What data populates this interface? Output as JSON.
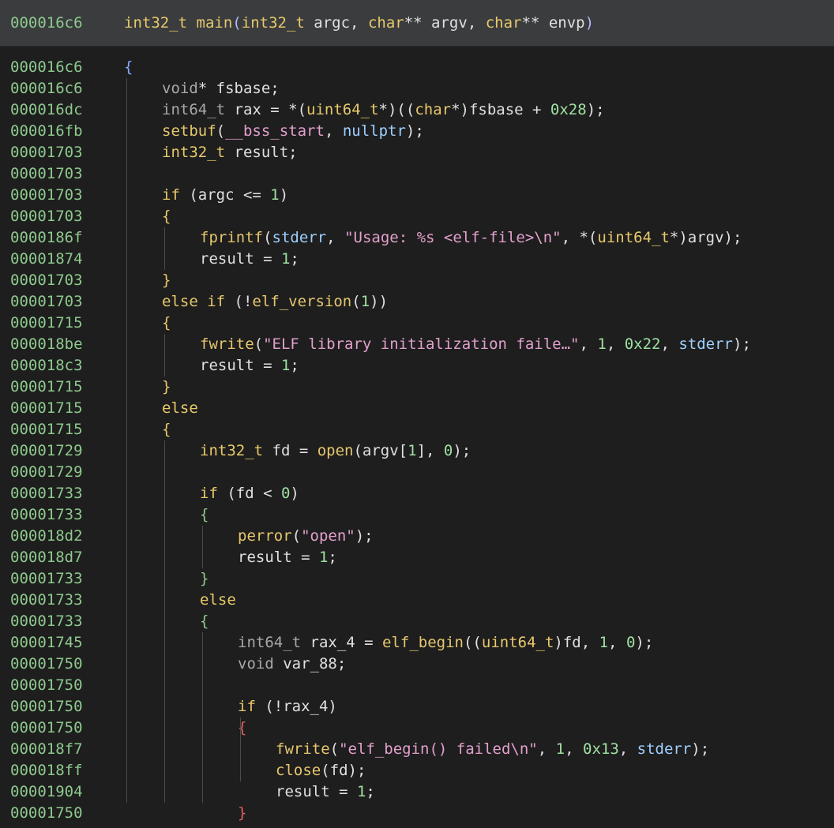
{
  "header": {
    "address": "000016c6",
    "return_type": "int32_t",
    "function_name": "main",
    "params": [
      {
        "type": "int32_t",
        "name": "argc"
      },
      {
        "type": "char",
        "ptr": "**",
        "name": "argv"
      },
      {
        "type": "char",
        "ptr": "**",
        "name": "envp"
      }
    ]
  },
  "lines": [
    {
      "addr": "000016c6",
      "indent": 0,
      "tokens": [
        [
          "{",
          "brace"
        ]
      ]
    },
    {
      "addr": "000016c6",
      "indent": 1,
      "tokens": [
        [
          "void",
          "type-dim"
        ],
        [
          "* fsbase;",
          "var"
        ]
      ]
    },
    {
      "addr": "000016dc",
      "indent": 1,
      "tokens": [
        [
          "int64_t",
          "type-dim"
        ],
        [
          " rax = *(",
          "var"
        ],
        [
          "uint64_t",
          "type"
        ],
        [
          "*)((",
          "var"
        ],
        [
          "char",
          "type"
        ],
        [
          "*)fsbase + ",
          "var"
        ],
        [
          "0x28",
          "num"
        ],
        [
          ");",
          "var"
        ]
      ]
    },
    {
      "addr": "000016fb",
      "indent": 1,
      "tokens": [
        [
          "setbuf",
          "func"
        ],
        [
          "(",
          "var"
        ],
        [
          "__bss_start",
          "pink"
        ],
        [
          ", ",
          "var"
        ],
        [
          "nullptr",
          "glob"
        ],
        [
          ");",
          "var"
        ]
      ]
    },
    {
      "addr": "00001703",
      "indent": 1,
      "tokens": [
        [
          "int32_t",
          "type"
        ],
        [
          " result;",
          "var"
        ]
      ]
    },
    {
      "addr": "00001703",
      "indent": 1,
      "tokens": []
    },
    {
      "addr": "00001703",
      "indent": 1,
      "tokens": [
        [
          "if",
          "kw"
        ],
        [
          " (argc <= ",
          "var"
        ],
        [
          "1",
          "num"
        ],
        [
          ")",
          "var"
        ]
      ]
    },
    {
      "addr": "00001703",
      "indent": 1,
      "tokens": [
        [
          "{",
          "brace-y"
        ]
      ]
    },
    {
      "addr": "0000186f",
      "indent": 2,
      "tokens": [
        [
          "fprintf",
          "func"
        ],
        [
          "(",
          "var"
        ],
        [
          "stderr",
          "glob"
        ],
        [
          ", ",
          "var"
        ],
        [
          "\"Usage: %s <elf-file>\\n\"",
          "str"
        ],
        [
          ", *(",
          "var"
        ],
        [
          "uint64_t",
          "type"
        ],
        [
          "*)argv);",
          "var"
        ]
      ]
    },
    {
      "addr": "00001874",
      "indent": 2,
      "tokens": [
        [
          "result = ",
          "var"
        ],
        [
          "1",
          "num"
        ],
        [
          ";",
          "var"
        ]
      ]
    },
    {
      "addr": "00001703",
      "indent": 1,
      "tokens": [
        [
          "}",
          "brace-y"
        ]
      ]
    },
    {
      "addr": "00001703",
      "indent": 1,
      "tokens": [
        [
          "else if",
          "kw"
        ],
        [
          " (!",
          "var"
        ],
        [
          "elf_version",
          "func"
        ],
        [
          "(",
          "var"
        ],
        [
          "1",
          "num"
        ],
        [
          "))",
          "var"
        ]
      ]
    },
    {
      "addr": "00001715",
      "indent": 1,
      "tokens": [
        [
          "{",
          "brace-y"
        ]
      ]
    },
    {
      "addr": "000018be",
      "indent": 2,
      "tokens": [
        [
          "fwrite",
          "func"
        ],
        [
          "(",
          "var"
        ],
        [
          "\"ELF library initialization faile…\"",
          "str"
        ],
        [
          ", ",
          "var"
        ],
        [
          "1",
          "num"
        ],
        [
          ", ",
          "var"
        ],
        [
          "0x22",
          "num"
        ],
        [
          ", ",
          "var"
        ],
        [
          "stderr",
          "glob"
        ],
        [
          ");",
          "var"
        ]
      ]
    },
    {
      "addr": "000018c3",
      "indent": 2,
      "tokens": [
        [
          "result = ",
          "var"
        ],
        [
          "1",
          "num"
        ],
        [
          ";",
          "var"
        ]
      ]
    },
    {
      "addr": "00001715",
      "indent": 1,
      "tokens": [
        [
          "}",
          "brace-y"
        ]
      ]
    },
    {
      "addr": "00001715",
      "indent": 1,
      "tokens": [
        [
          "else",
          "kw"
        ]
      ]
    },
    {
      "addr": "00001715",
      "indent": 1,
      "tokens": [
        [
          "{",
          "brace-y"
        ]
      ]
    },
    {
      "addr": "00001729",
      "indent": 2,
      "tokens": [
        [
          "int32_t",
          "type"
        ],
        [
          " fd = ",
          "var"
        ],
        [
          "open",
          "func"
        ],
        [
          "(argv[",
          "var"
        ],
        [
          "1",
          "num"
        ],
        [
          "], ",
          "var"
        ],
        [
          "0",
          "num"
        ],
        [
          ");",
          "var"
        ]
      ]
    },
    {
      "addr": "00001729",
      "indent": 2,
      "tokens": []
    },
    {
      "addr": "00001733",
      "indent": 2,
      "tokens": [
        [
          "if",
          "kw"
        ],
        [
          " (fd < ",
          "var"
        ],
        [
          "0",
          "num"
        ],
        [
          ")",
          "var"
        ]
      ]
    },
    {
      "addr": "00001733",
      "indent": 2,
      "tokens": [
        [
          "{",
          "brace-g"
        ]
      ]
    },
    {
      "addr": "000018d2",
      "indent": 3,
      "tokens": [
        [
          "perror",
          "func"
        ],
        [
          "(",
          "var"
        ],
        [
          "\"open\"",
          "str"
        ],
        [
          ");",
          "var"
        ]
      ]
    },
    {
      "addr": "000018d7",
      "indent": 3,
      "tokens": [
        [
          "result = ",
          "var"
        ],
        [
          "1",
          "num"
        ],
        [
          ";",
          "var"
        ]
      ]
    },
    {
      "addr": "00001733",
      "indent": 2,
      "tokens": [
        [
          "}",
          "brace-g"
        ]
      ]
    },
    {
      "addr": "00001733",
      "indent": 2,
      "tokens": [
        [
          "else",
          "kw"
        ]
      ]
    },
    {
      "addr": "00001733",
      "indent": 2,
      "tokens": [
        [
          "{",
          "brace-g"
        ]
      ]
    },
    {
      "addr": "00001745",
      "indent": 3,
      "tokens": [
        [
          "int64_t",
          "type-dim"
        ],
        [
          " rax_4 = ",
          "var"
        ],
        [
          "elf_begin",
          "func"
        ],
        [
          "((",
          "var"
        ],
        [
          "uint64_t",
          "type"
        ],
        [
          ")fd, ",
          "var"
        ],
        [
          "1",
          "num"
        ],
        [
          ", ",
          "var"
        ],
        [
          "0",
          "num"
        ],
        [
          ");",
          "var"
        ]
      ]
    },
    {
      "addr": "00001750",
      "indent": 3,
      "tokens": [
        [
          "void",
          "type-dim"
        ],
        [
          " var_88;",
          "var"
        ]
      ]
    },
    {
      "addr": "00001750",
      "indent": 3,
      "tokens": []
    },
    {
      "addr": "00001750",
      "indent": 3,
      "tokens": [
        [
          "if",
          "kw"
        ],
        [
          " (!rax_4)",
          "var"
        ]
      ]
    },
    {
      "addr": "00001750",
      "indent": 3,
      "tokens": [
        [
          "{",
          "brace-r"
        ]
      ]
    },
    {
      "addr": "000018f7",
      "indent": 4,
      "tokens": [
        [
          "fwrite",
          "func"
        ],
        [
          "(",
          "var"
        ],
        [
          "\"elf_begin() failed\\n\"",
          "str"
        ],
        [
          ", ",
          "var"
        ],
        [
          "1",
          "num"
        ],
        [
          ", ",
          "var"
        ],
        [
          "0x13",
          "num"
        ],
        [
          ", ",
          "var"
        ],
        [
          "stderr",
          "glob"
        ],
        [
          ");",
          "var"
        ]
      ]
    },
    {
      "addr": "000018ff",
      "indent": 4,
      "tokens": [
        [
          "close",
          "func"
        ],
        [
          "(fd);",
          "var"
        ]
      ]
    },
    {
      "addr": "00001904",
      "indent": 4,
      "tokens": [
        [
          "result = ",
          "var"
        ],
        [
          "1",
          "num"
        ],
        [
          ";",
          "var"
        ]
      ]
    },
    {
      "addr": "00001750",
      "indent": 3,
      "tokens": [
        [
          "}",
          "brace-r"
        ]
      ]
    }
  ],
  "colors": {
    "background": "#1e1e1e",
    "header_bg": "#3a3c3e",
    "address": "#8ec98e",
    "type": "#e8c96a",
    "string": "#e2a0cc",
    "number": "#9fe0a0",
    "global": "#9fcfff"
  }
}
